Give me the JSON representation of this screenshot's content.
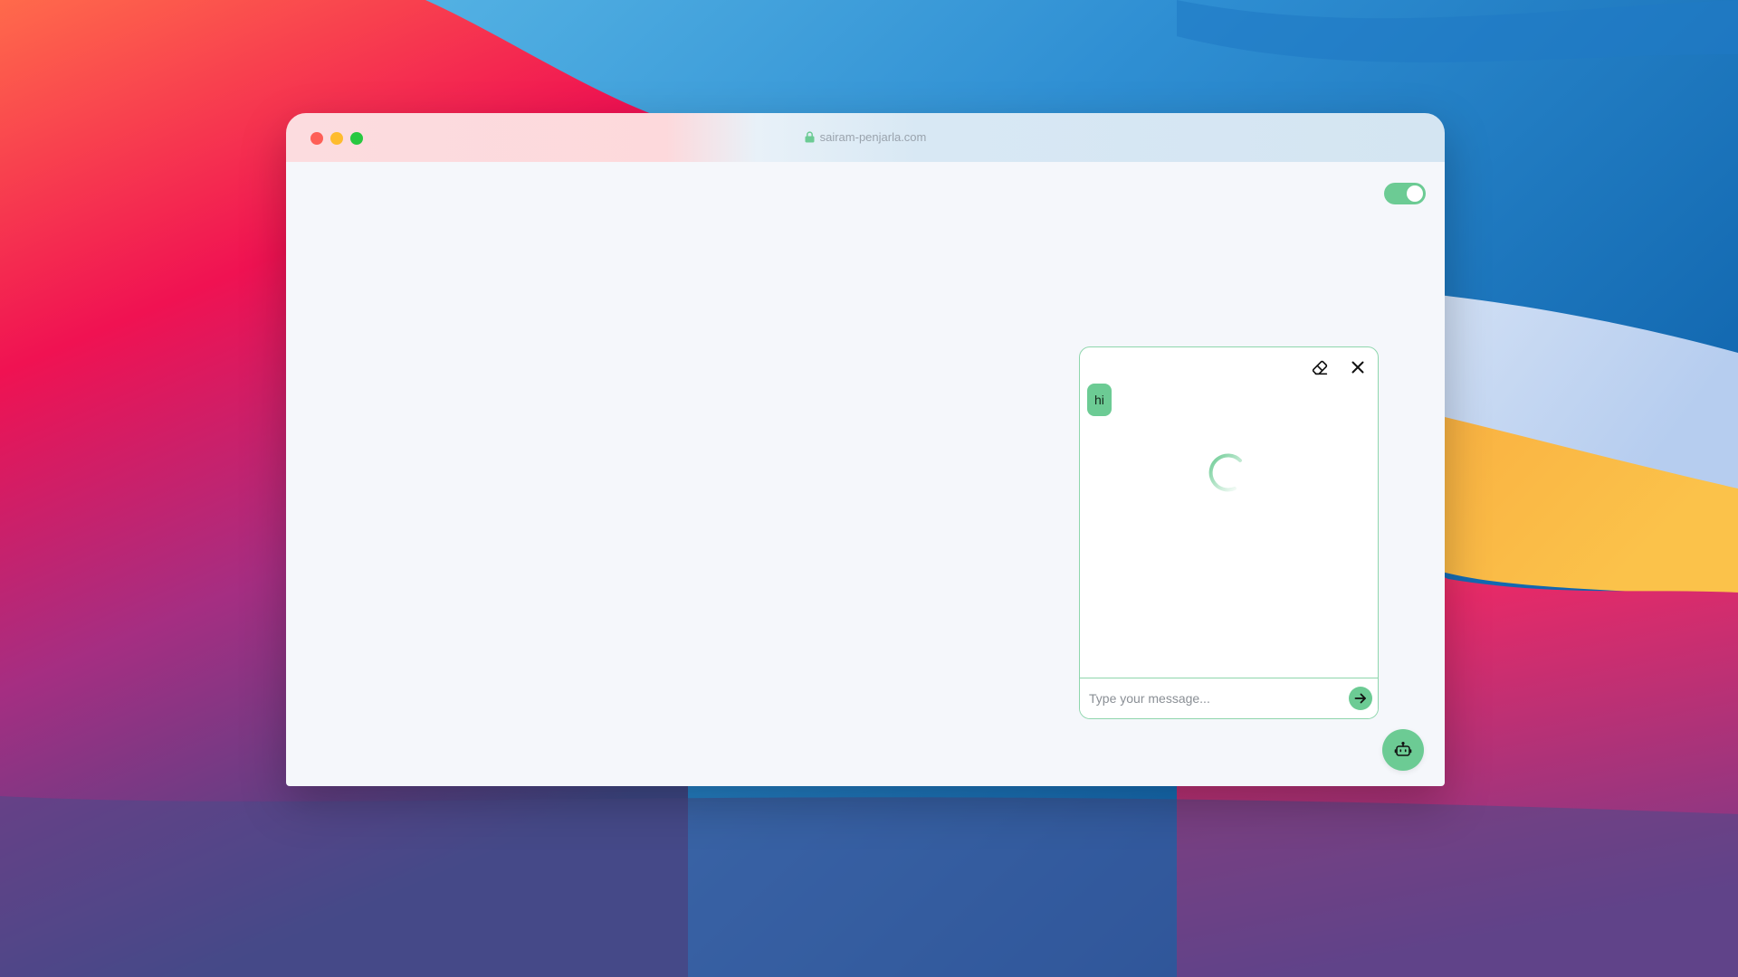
{
  "browser": {
    "address": "sairam-penjarla.com"
  },
  "page": {
    "toggle_state": "on"
  },
  "chat": {
    "messages": [
      {
        "role": "user",
        "text": "hi"
      }
    ],
    "status": "loading",
    "input": {
      "value": "",
      "placeholder": "Type your message..."
    },
    "icons": {
      "clear": "eraser-icon",
      "close": "close-icon",
      "send": "arrow-right-icon",
      "launcher": "robot-icon"
    }
  },
  "colors": {
    "accent": "#6ccb94",
    "accent_border": "#8fd6ad",
    "page_bg": "#f5f7fb"
  }
}
